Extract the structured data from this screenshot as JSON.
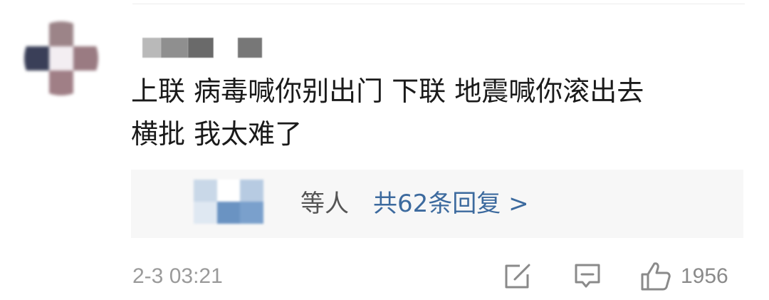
{
  "comment": {
    "author_name": "",
    "text": "上联 病毒喊你别出门 下联 地震喊你滚出去\n横批 我太难了",
    "timestamp": "2-3 03:21",
    "like_count": "1956"
  },
  "replies": {
    "names_suffix": "等人",
    "link_label": "共62条回复 >"
  },
  "icons": {
    "share": "share-edit-icon",
    "comment": "comment-icon",
    "like": "thumbs-up-icon"
  },
  "colors": {
    "link": "#3c6a9e",
    "text": "#1a1a1a",
    "muted": "#9a9a9a",
    "reply_bg": "#f7f7f7"
  }
}
